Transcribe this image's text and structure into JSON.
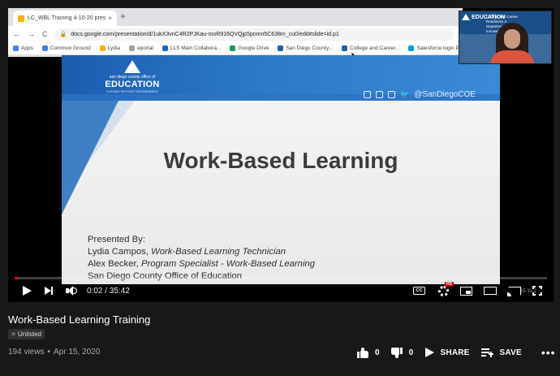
{
  "browser": {
    "tab_title": "LC_WBL Training 4-10-20 preser",
    "tab_close": "×",
    "new_tab": "+",
    "nav_back": "←",
    "nav_forward": "→",
    "nav_reload": "C",
    "url": "docs.google.com/presentation/d/1ukX3vnC4R2PJKau-moR916QVQjp5pnmn5C638m_cu0/edit#slide=id.p1",
    "bookmarks": [
      {
        "label": "Apps",
        "color": "#4285f4"
      },
      {
        "label": "Common Ground",
        "color": "#4a7bd0"
      },
      {
        "label": "Lydia",
        "color": "#f4b400"
      },
      {
        "label": "eportal",
        "color": "#a0a0a0"
      },
      {
        "label": "LLS Main Collabora...",
        "color": "#1e63c4"
      },
      {
        "label": "Google Drive",
        "color": "#0f9d58"
      },
      {
        "label": "San Diego County...",
        "color": "#1b5db0"
      },
      {
        "label": "College and Career...",
        "color": "#1b5db0"
      },
      {
        "label": "Salesforce login Pro",
        "color": "#00a1e0"
      }
    ]
  },
  "cam": {
    "logo": "EDUCATION",
    "text": "College and Career Readiness A Department of the Innovative Division"
  },
  "slide": {
    "logo_top": "san diego county office of",
    "logo_main": "EDUCATION",
    "logo_bottom": "FUTURE WITHOUT BOUNDARIES",
    "social_handle": "@SanDiegoCOE",
    "title": "Work-Based Learning",
    "presented_by": "Presented By:",
    "line1_name": "Lydia Campos, ",
    "line1_role": "Work-Based Learning Technician",
    "line2_name": "Alex Becker, ",
    "line2_role": "Program Specialist - Work-Based Learning",
    "line3": "San Diego County Office of Education"
  },
  "player": {
    "time": "0:02 / 35:42",
    "cc_label": "CC",
    "hd_label": "HD",
    "progress_fraction": 0.001,
    "overlay_time": "15 31 2"
  },
  "video": {
    "title": "Work-Based Learning Training",
    "visibility": "Unlisted",
    "views": "194 views",
    "dot": "•",
    "date": "Apr 15, 2020"
  },
  "actions": {
    "like_count": "0",
    "dislike_count": "0",
    "share_label": "SHARE",
    "save_label": "SAVE",
    "more": "•••"
  }
}
